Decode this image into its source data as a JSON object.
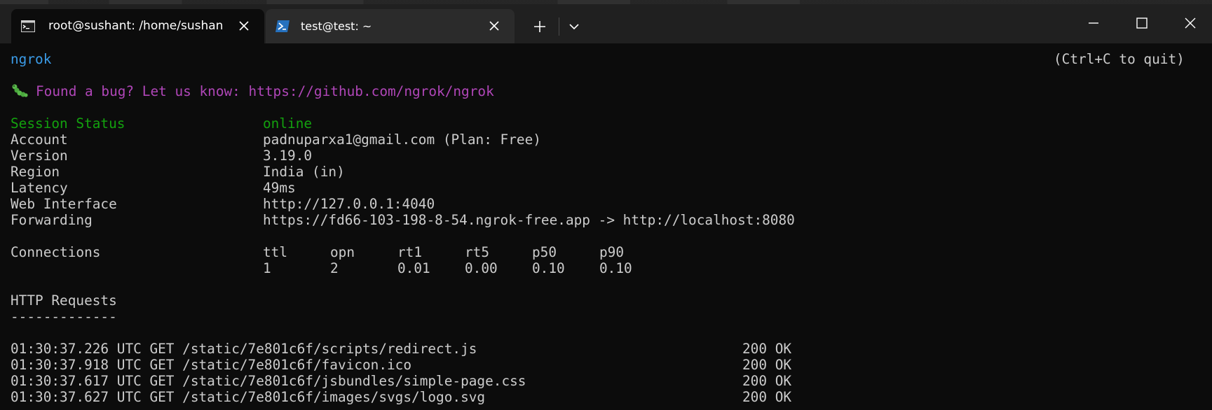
{
  "window": {
    "tabs": [
      {
        "title": "root@sushant: /home/sushan",
        "icon": "command-prompt-icon"
      },
      {
        "title": "test@test: ~",
        "icon": "powershell-icon"
      }
    ],
    "controls": {
      "new_tab": "plus-icon",
      "dropdown": "chevron-down-icon",
      "minimize": "minimize-icon",
      "maximize": "maximize-icon",
      "close": "close-icon"
    }
  },
  "terminal": {
    "app_name": "ngrok",
    "quit_hint": "(Ctrl+C to quit)",
    "bug_prefix_icon": "caterpillar-icon",
    "bug_message": "Found a bug? Let us know: https://github.com/ngrok/ngrok",
    "info": [
      {
        "label": "Session Status",
        "value": "online"
      },
      {
        "label": "Account",
        "value": "padnuparxa1@gmail.com (Plan: Free)"
      },
      {
        "label": "Version",
        "value": "3.19.0"
      },
      {
        "label": "Region",
        "value": "India (in)"
      },
      {
        "label": "Latency",
        "value": "49ms"
      },
      {
        "label": "Web Interface",
        "value": "http://127.0.0.1:4040"
      },
      {
        "label": "Forwarding",
        "value": "https://fd66-103-198-8-54.ngrok-free.app -> http://localhost:8080"
      }
    ],
    "connections": {
      "label": "Connections",
      "headers": [
        "ttl",
        "opn",
        "rt1",
        "rt5",
        "p50",
        "p90"
      ],
      "values": [
        "1",
        "2",
        "0.01",
        "0.00",
        "0.10",
        "0.10"
      ]
    },
    "http_requests": {
      "title": "HTTP Requests",
      "underline": "-------------",
      "rows": [
        {
          "time": "01:30:37.226 UTC GET /static/7e801c6f/scripts/redirect.js",
          "status": "200 OK"
        },
        {
          "time": "01:30:37.918 UTC GET /static/7e801c6f/favicon.ico",
          "status": "200 OK"
        },
        {
          "time": "01:30:37.617 UTC GET /static/7e801c6f/jsbundles/simple-page.css",
          "status": "200 OK"
        },
        {
          "time": "01:30:37.627 UTC GET /static/7e801c6f/images/svgs/logo.svg",
          "status": "200 OK"
        }
      ]
    }
  },
  "colors": {
    "green": "#13a10e",
    "blue": "#3b9ce8",
    "purple": "#b046b8",
    "text": "#cccccc",
    "background": "#0c0c0c"
  }
}
